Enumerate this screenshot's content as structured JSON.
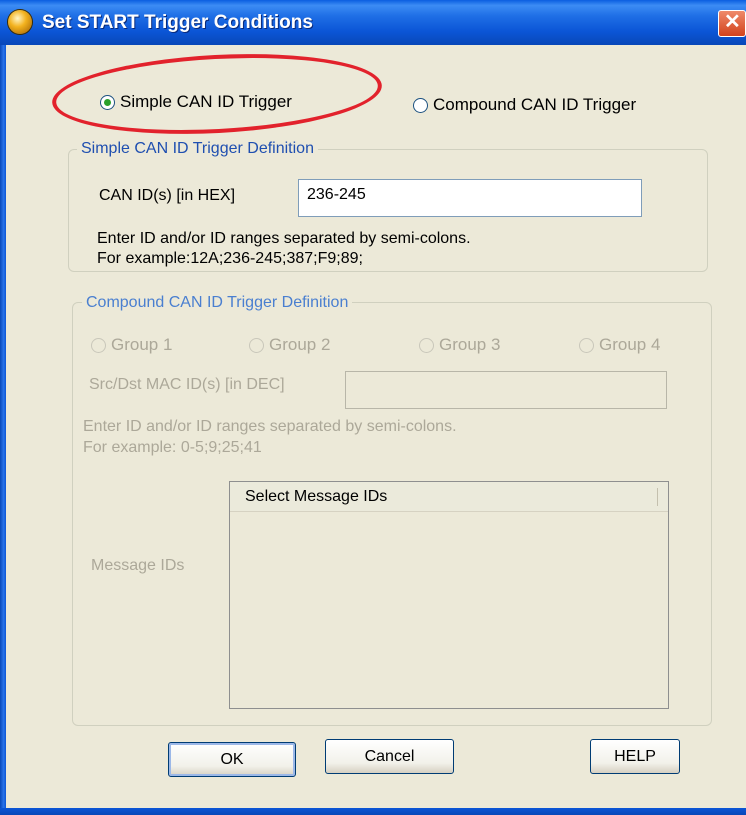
{
  "window": {
    "title": "Set START Trigger Conditions",
    "close_glyph": "✕"
  },
  "trigger_type": {
    "simple_label": "Simple CAN ID Trigger",
    "compound_label": "Compound CAN ID Trigger",
    "selected": "simple"
  },
  "simple_group": {
    "legend": "Simple CAN ID Trigger Definition",
    "can_id_label": "CAN ID(s) [in HEX]",
    "can_id_value": "236-245",
    "hint_line1": "Enter ID and/or ID ranges separated by semi-colons.",
    "hint_line2": "For example:12A;236-245;387;F9;89;"
  },
  "compound_group": {
    "legend": "Compound CAN ID Trigger Definition",
    "groups": [
      "Group 1",
      "Group 2",
      "Group 3",
      "Group 4"
    ],
    "mac_label": "Src/Dst MAC ID(s) [in DEC]",
    "mac_value": "",
    "hint_line1": "Enter ID and/or ID ranges separated by semi-colons.",
    "hint_line2": "For example: 0-5;9;25;41",
    "message_ids_label": "Message IDs",
    "list_header": "Select Message IDs"
  },
  "buttons": {
    "ok": "OK",
    "cancel": "Cancel",
    "help": "HELP"
  },
  "colors": {
    "annotation": "#e2222c",
    "titlebar": "#0b55d6",
    "dialog_bg": "#ece9d8"
  }
}
